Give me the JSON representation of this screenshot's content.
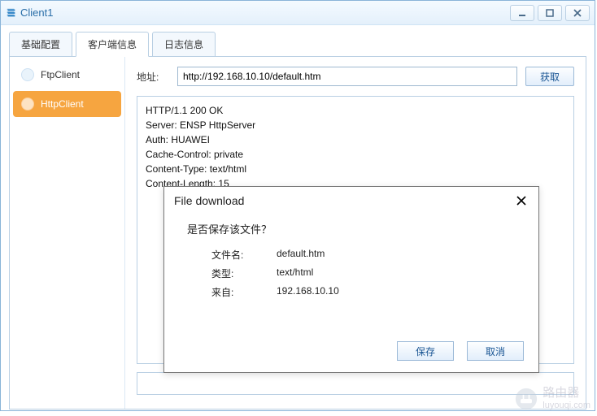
{
  "window": {
    "title": "Client1"
  },
  "tabs": {
    "active": 1,
    "items": [
      "基础配置",
      "客户端信息",
      "日志信息"
    ]
  },
  "sidebar": {
    "active": 1,
    "items": [
      "FtpClient",
      "HttpClient"
    ]
  },
  "address": {
    "label": "地址:",
    "value": "http://192.168.10.10/default.htm",
    "fetch_label": "获取"
  },
  "response": "HTTP/1.1 200 OK\nServer: ENSP HttpServer\nAuth: HUAWEI\nCache-Control: private\nContent-Type: text/html\nContent-Length: 15",
  "dialog": {
    "title": "File download",
    "question": "是否保存该文件？",
    "rows": {
      "filename_label": "文件名:",
      "filename_value": "default.htm",
      "type_label": "类型:",
      "type_value": "text/html",
      "from_label": "来自:",
      "from_value": "192.168.10.10"
    },
    "save_label": "保存",
    "cancel_label": "取消"
  },
  "watermark": {
    "brand": "路由器",
    "sub": "luyouqi.com"
  }
}
